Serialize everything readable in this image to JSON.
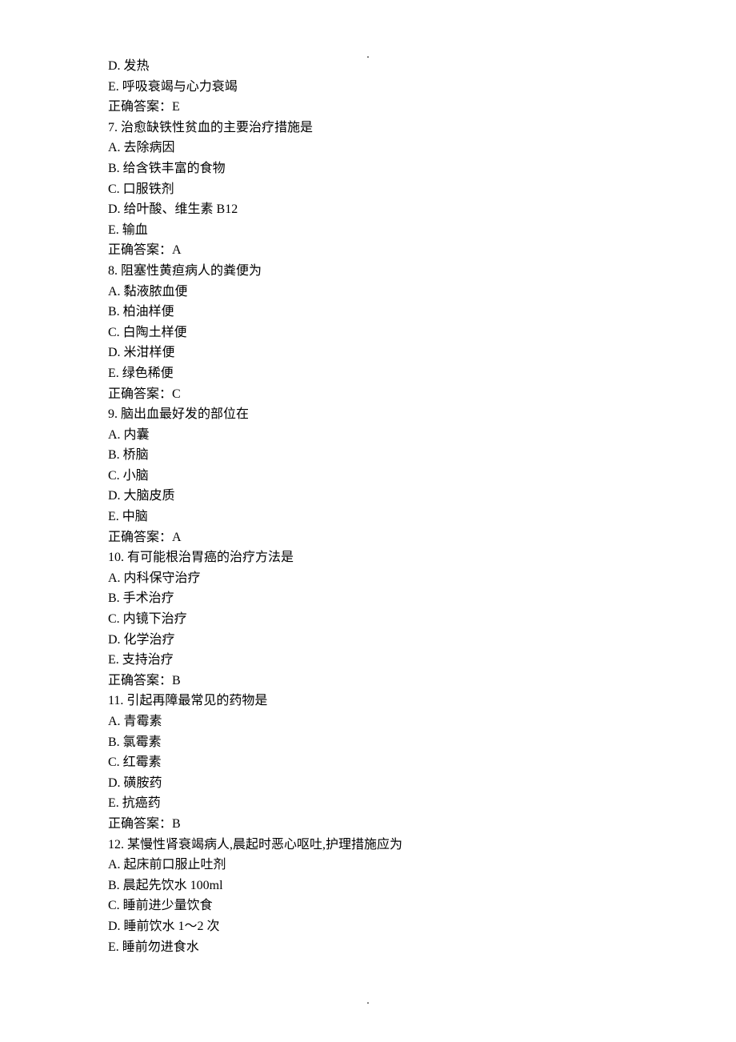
{
  "decor": {
    "top": ".",
    "bottom": "."
  },
  "items": [
    {
      "text": "D. 发热"
    },
    {
      "text": "E. 呼吸衰竭与心力衰竭"
    },
    {
      "text": "正确答案：E"
    },
    {
      "text": "7.  治愈缺铁性贫血的主要治疗措施是"
    },
    {
      "text": "A. 去除病因"
    },
    {
      "text": "B. 给含铁丰富的食物"
    },
    {
      "text": "C. 口服铁剂"
    },
    {
      "text": "D. 给叶酸、维生素 B12"
    },
    {
      "text": "E. 输血"
    },
    {
      "text": "正确答案：A"
    },
    {
      "text": "8.  阻塞性黄疸病人的粪便为"
    },
    {
      "text": "A. 黏液脓血便"
    },
    {
      "text": "B. 柏油样便"
    },
    {
      "text": "C. 白陶土样便"
    },
    {
      "text": "D. 米泔样便"
    },
    {
      "text": "E. 绿色稀便"
    },
    {
      "text": "正确答案：C"
    },
    {
      "text": "9.  脑出血最好发的部位在"
    },
    {
      "text": "A. 内囊"
    },
    {
      "text": "B. 桥脑"
    },
    {
      "text": "C. 小脑"
    },
    {
      "text": "D. 大脑皮质"
    },
    {
      "text": "E. 中脑"
    },
    {
      "text": "正确答案：A"
    },
    {
      "text": "10.  有可能根治胃癌的治疗方法是"
    },
    {
      "text": "A. 内科保守治疗"
    },
    {
      "text": "B. 手术治疗"
    },
    {
      "text": "C. 内镜下治疗"
    },
    {
      "text": "D. 化学治疗"
    },
    {
      "text": "E. 支持治疗"
    },
    {
      "text": "正确答案：B"
    },
    {
      "text": "11.  引起再障最常见的药物是"
    },
    {
      "text": "A. 青霉素"
    },
    {
      "text": "B. 氯霉素"
    },
    {
      "text": "C. 红霉素"
    },
    {
      "text": "D. 磺胺药"
    },
    {
      "text": "E. 抗癌药"
    },
    {
      "text": "正确答案：B"
    },
    {
      "text": "12.  某慢性肾衰竭病人,晨起时恶心呕吐,护理措施应为"
    },
    {
      "text": "A. 起床前口服止吐剂"
    },
    {
      "text": "B. 晨起先饮水 100ml"
    },
    {
      "text": "C. 睡前进少量饮食"
    },
    {
      "text": "D. 睡前饮水 1～2 次"
    },
    {
      "text": "E. 睡前勿进食水"
    }
  ]
}
